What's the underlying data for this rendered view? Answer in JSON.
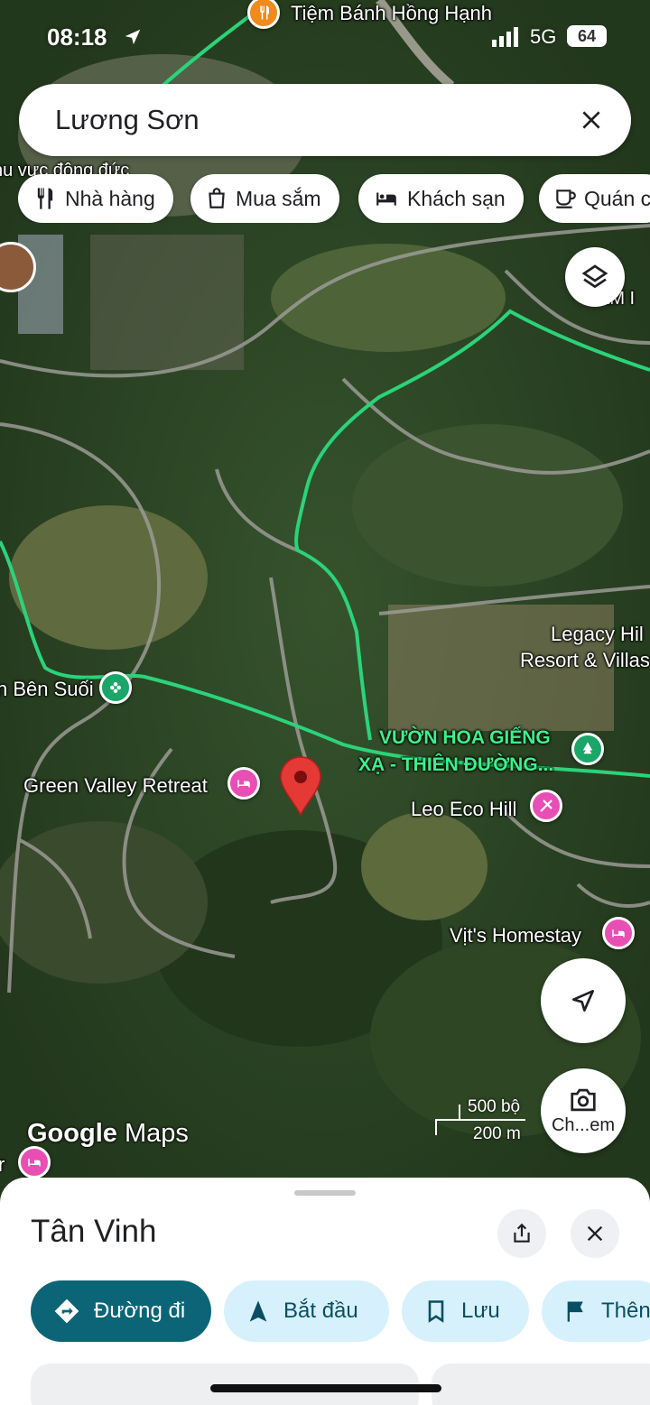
{
  "status_bar": {
    "time": "08:18",
    "network": "5G",
    "battery": "64"
  },
  "search": {
    "query": "Lương Sơn"
  },
  "chips": [
    {
      "label": "Nhà hàng",
      "icon": "restaurant-icon"
    },
    {
      "label": "Mua sắm",
      "icon": "shopping-bag-icon"
    },
    {
      "label": "Khách sạn",
      "icon": "hotel-icon"
    },
    {
      "label": "Quán c",
      "icon": "coffee-icon"
    }
  ],
  "map": {
    "labels": {
      "bakery": "Tiệm Bánh Hồng Hạnh",
      "industrial": "hu vực động đức",
      "corner_right": "AM I",
      "legacy_line1": "Legacy Hil",
      "legacy_line2": "Resort & Villas",
      "ben_suoi": "n Bên Suối",
      "garden_line1": "VƯỜN HOA GIẾNG",
      "garden_line2": "XẠ - THIÊN ĐƯỜNG...",
      "green_valley": "Green Valley Retreat",
      "leo_eco": "Leo Eco Hill",
      "vits_homestay": "Vịt's Homestay",
      "bottom_left": "r"
    },
    "scale": {
      "imperial": "500 bộ",
      "metric": "200 m"
    },
    "logo": {
      "brand": "Google",
      "product": "Maps"
    },
    "camera_label": "Ch...em",
    "colors": {
      "route": "#2bd37a",
      "pin_red": "#e53935",
      "hotel_pink": "#e84fb4"
    }
  },
  "sheet": {
    "title": "Tân Vinh",
    "actions": [
      {
        "label": "Đường đi",
        "icon": "directions-icon"
      },
      {
        "label": "Bắt đầu",
        "icon": "navigation-arrow-icon"
      },
      {
        "label": "Lưu",
        "icon": "bookmark-icon"
      },
      {
        "label": "Thên",
        "icon": "flag-icon"
      }
    ]
  }
}
